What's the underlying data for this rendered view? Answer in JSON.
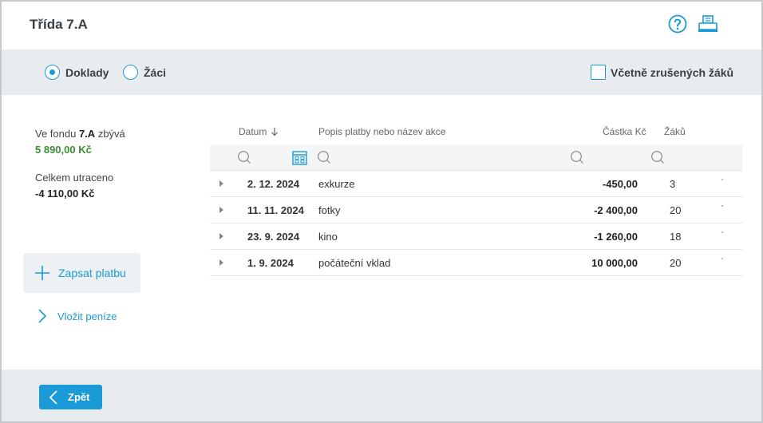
{
  "header": {
    "title": "Třída 7.A"
  },
  "filters": {
    "radio_documents": "Doklady",
    "radio_students": "Žáci",
    "include_cancelled": "Včetně zrušených žáků"
  },
  "fund": {
    "prefix": "Ve fondu",
    "class": "7.A",
    "suffix": "zbývá",
    "remaining": "5 890,00 Kč",
    "spent_label": "Celkem utraceno",
    "spent": "-4 110,00 Kč"
  },
  "actions": {
    "add_payment": "Zapsat platbu",
    "deposit": "Vložit peníze"
  },
  "table": {
    "columns": {
      "date": "Datum",
      "description": "Popis platby nebo název akce",
      "amount": "Částka Kč",
      "students": "Žáků"
    },
    "rows": [
      {
        "date": "2. 12. 2024",
        "description": "exkurze",
        "amount": "-450,00",
        "students": "3"
      },
      {
        "date": "11. 11. 2024",
        "description": "fotky",
        "amount": "-2 400,00",
        "students": "20"
      },
      {
        "date": "23. 9. 2024",
        "description": "kino",
        "amount": "-1 260,00",
        "students": "18"
      },
      {
        "date": "1. 9. 2024",
        "description": "počáteční vklad",
        "amount": "10 000,00",
        "students": "20"
      }
    ]
  },
  "footer": {
    "back": "Zpět"
  },
  "colors": {
    "accent": "#1a9ad6",
    "positive": "#3c8e35",
    "bar": "#e9ecee"
  },
  "icons": {
    "help": "help-icon",
    "print": "print-icon",
    "search": "search-icon",
    "calendar": "calendar-icon",
    "sort": "sort-down-icon",
    "plus": "plus-icon",
    "chevron_right": "chevron-right-icon",
    "chevron_left": "chevron-left-icon"
  }
}
